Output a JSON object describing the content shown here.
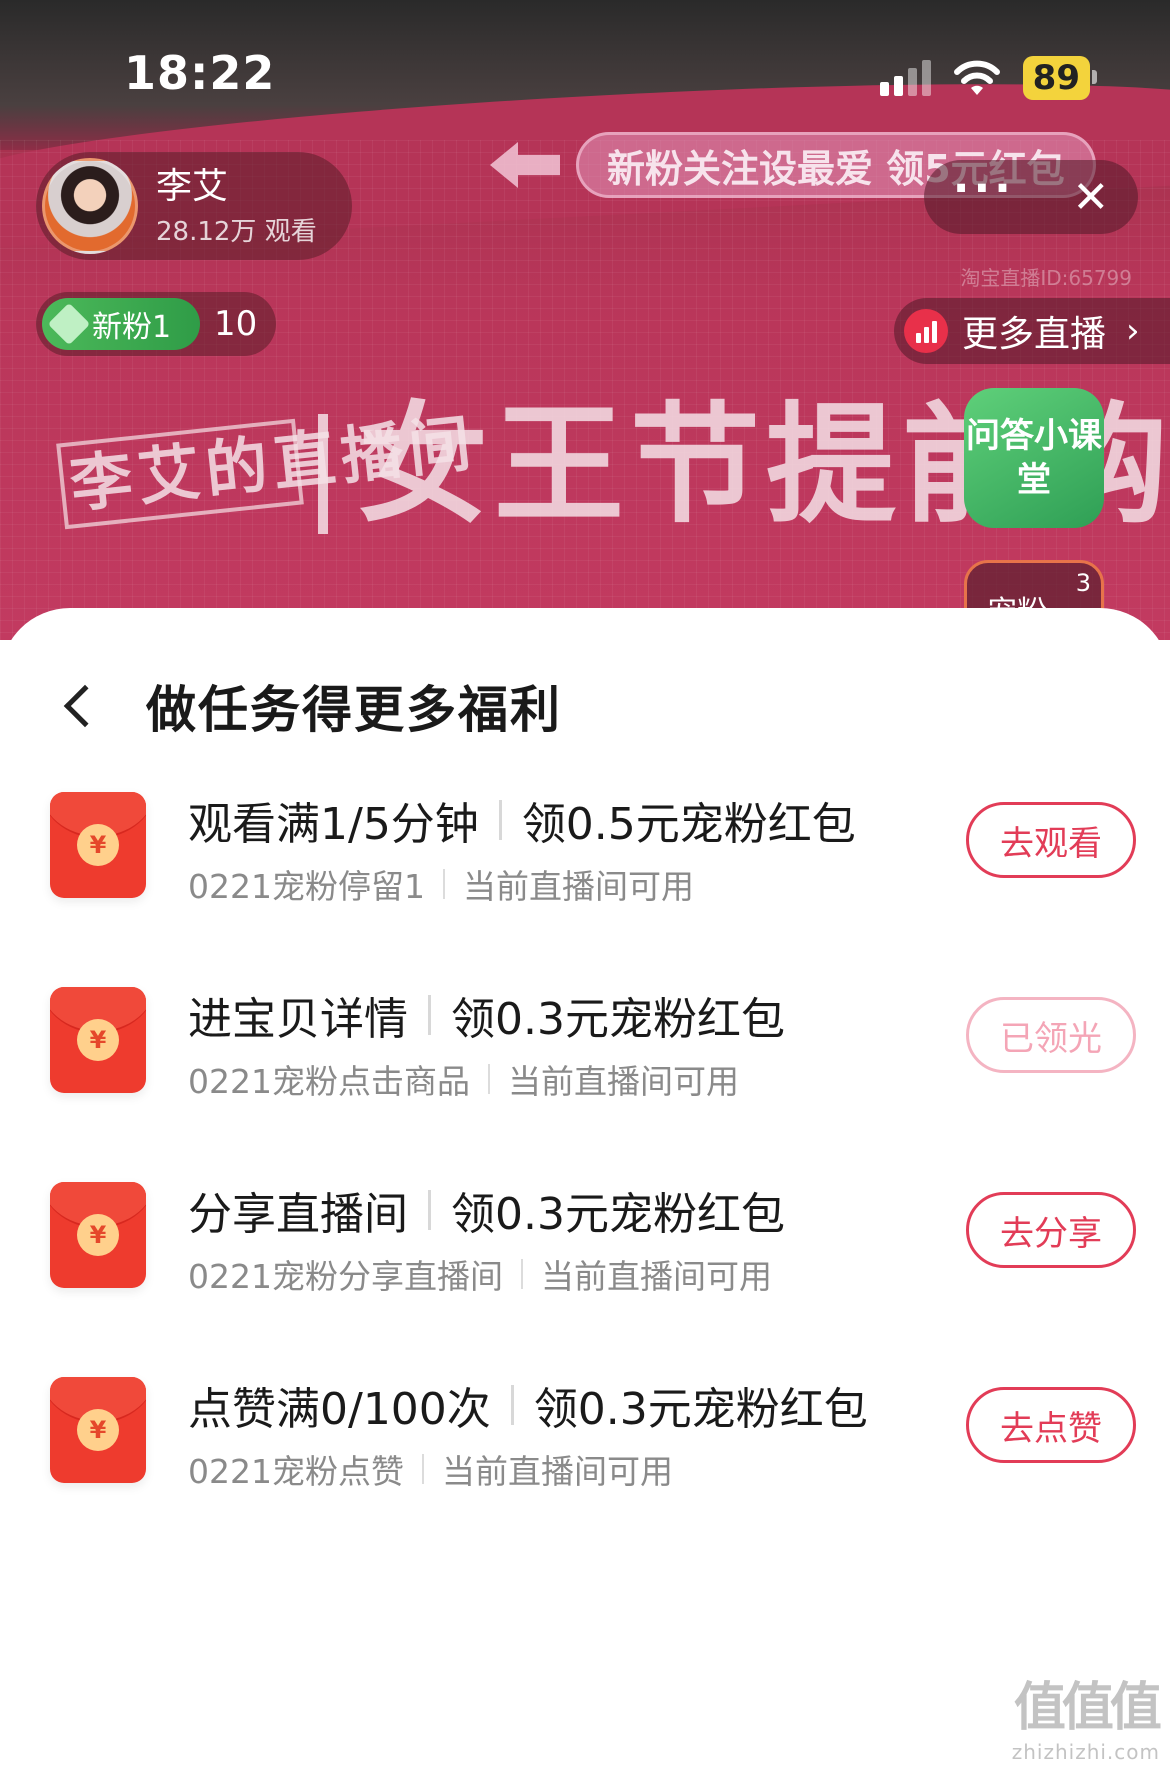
{
  "status_bar": {
    "time": "18:22",
    "battery": "89"
  },
  "live": {
    "host_name": "李艾",
    "viewers": "28.12万 观看",
    "fan_badge": "新粉1",
    "fan_count": "10",
    "banner_ad": "新粉关注设最爱 领5元红包",
    "more_icon": "···",
    "close_icon": "✕",
    "live_id": "淘宝直播ID:65799",
    "more_live": "更多直播",
    "title_brand": "李艾的直播间",
    "title_text": "女王节提前购",
    "qa_label": "问答小课堂",
    "fan_box_label": "宠粉",
    "fan_box_num": "3"
  },
  "sheet": {
    "title": "做任务得更多福利",
    "tasks": [
      {
        "name": "观看满1/5分钟",
        "reward": "领0.5元宠粉红包",
        "code": "0221宠粉停留1",
        "scope": "当前直播间可用",
        "button": "去观看",
        "enabled": true
      },
      {
        "name": "进宝贝详情",
        "reward": "领0.3元宠粉红包",
        "code": "0221宠粉点击商品",
        "scope": "当前直播间可用",
        "button": "已领光",
        "enabled": false
      },
      {
        "name": "分享直播间",
        "reward": "领0.3元宠粉红包",
        "code": "0221宠粉分享直播间",
        "scope": "当前直播间可用",
        "button": "去分享",
        "enabled": true
      },
      {
        "name": "点赞满0/100次",
        "reward": "领0.3元宠粉红包",
        "code": "0221宠粉点赞",
        "scope": "当前直播间可用",
        "button": "去点赞",
        "enabled": true
      }
    ],
    "coin_symbol": "¥"
  },
  "watermark": {
    "logo": "值值值",
    "url": "zhizhizhi.com"
  },
  "colors": {
    "accent": "#e23c57",
    "envelope": "#ee3b2e",
    "disabled": "#f4a5b6"
  }
}
